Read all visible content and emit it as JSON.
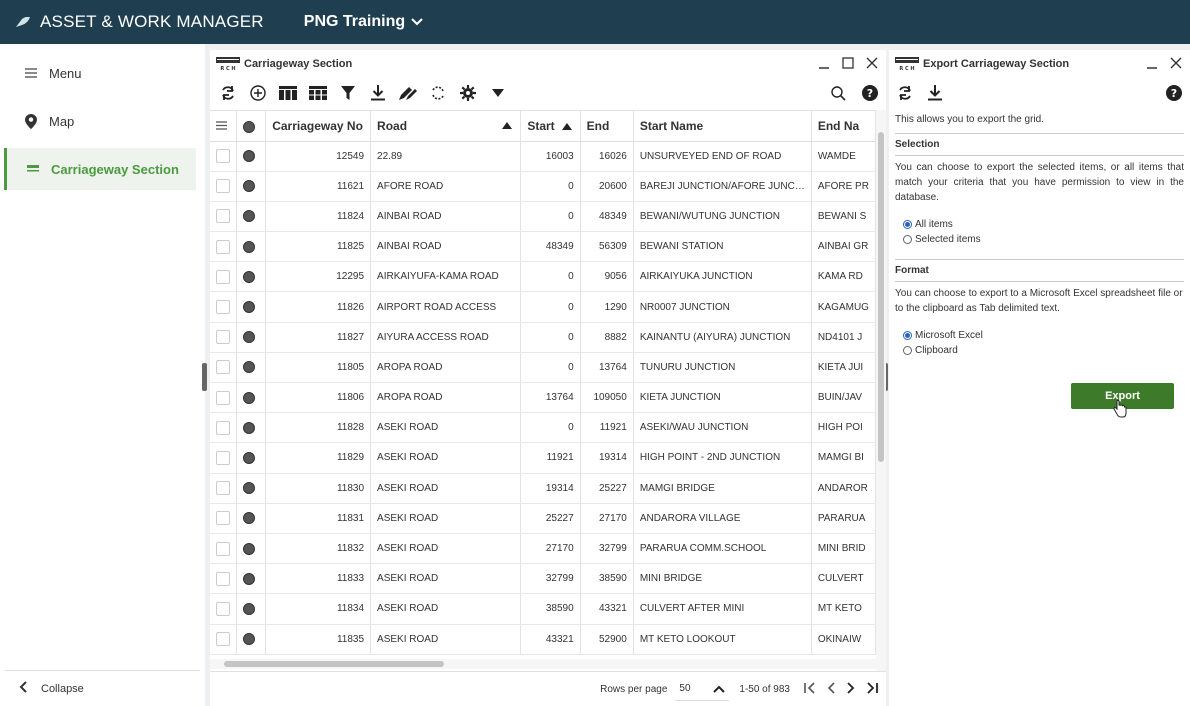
{
  "app": {
    "title": "ASSET & WORK MANAGER",
    "tenant": "PNG Training"
  },
  "sidebar": {
    "items": [
      {
        "label": "Menu",
        "icon": "hamburger-icon"
      },
      {
        "label": "Map",
        "icon": "map-pin-icon"
      },
      {
        "label": "Carriageway Section",
        "icon": "carriageway-icon",
        "active": true
      }
    ],
    "collapse_label": "Collapse",
    "accent_color": "#4a9a3e"
  },
  "grid_panel": {
    "title": "Carriageway Section",
    "columns": [
      "",
      "",
      "Carriageway No",
      "Road",
      "Start",
      "End",
      "Start Name",
      "End Na"
    ],
    "rows": [
      {
        "no": "12549",
        "road": "22.89",
        "start": "16003",
        "end": "16026",
        "start_name": "UNSURVEYED END OF ROAD",
        "end_name": "WAMDE"
      },
      {
        "no": "11621",
        "road": "AFORE ROAD",
        "start": "0",
        "end": "20600",
        "start_name": "BAREJI JUNCTION/AFORE JUNC…",
        "end_name": "AFORE PR"
      },
      {
        "no": "11824",
        "road": "AINBAI ROAD",
        "start": "0",
        "end": "48349",
        "start_name": "BEWANI/WUTUNG JUNCTION",
        "end_name": "BEWANI S"
      },
      {
        "no": "11825",
        "road": "AINBAI ROAD",
        "start": "48349",
        "end": "56309",
        "start_name": "BEWANI STATION",
        "end_name": "AINBAI GR"
      },
      {
        "no": "12295",
        "road": "AIRKAIYUFA-KAMA ROAD",
        "start": "0",
        "end": "9056",
        "start_name": "AIRKAIYUKA JUNCTION",
        "end_name": "KAMA RD"
      },
      {
        "no": "11826",
        "road": "AIRPORT ROAD ACCESS",
        "start": "0",
        "end": "1290",
        "start_name": "NR0007 JUNCTION",
        "end_name": "KAGAMUG"
      },
      {
        "no": "11827",
        "road": "AIYURA ACCESS ROAD",
        "start": "0",
        "end": "8882",
        "start_name": "KAINANTU (AIYURA) JUNCTION",
        "end_name": "ND4101 J"
      },
      {
        "no": "11805",
        "road": "AROPA ROAD",
        "start": "0",
        "end": "13764",
        "start_name": "TUNURU JUNCTION",
        "end_name": "KIETA JUI"
      },
      {
        "no": "11806",
        "road": "AROPA ROAD",
        "start": "13764",
        "end": "109050",
        "start_name": "KIETA JUNCTION",
        "end_name": "BUIN/JAV"
      },
      {
        "no": "11828",
        "road": "ASEKI ROAD",
        "start": "0",
        "end": "11921",
        "start_name": "ASEKI/WAU JUNCTION",
        "end_name": "HIGH POI"
      },
      {
        "no": "11829",
        "road": "ASEKI ROAD",
        "start": "11921",
        "end": "19314",
        "start_name": "HIGH POINT - 2ND JUNCTION",
        "end_name": "MAMGI BI"
      },
      {
        "no": "11830",
        "road": "ASEKI ROAD",
        "start": "19314",
        "end": "25227",
        "start_name": "MAMGI BRIDGE",
        "end_name": "ANDAROR"
      },
      {
        "no": "11831",
        "road": "ASEKI ROAD",
        "start": "25227",
        "end": "27170",
        "start_name": "ANDARORA VILLAGE",
        "end_name": "PARARUA"
      },
      {
        "no": "11832",
        "road": "ASEKI ROAD",
        "start": "27170",
        "end": "32799",
        "start_name": "PARARUA COMM.SCHOOL",
        "end_name": "MINI BRID"
      },
      {
        "no": "11833",
        "road": "ASEKI ROAD",
        "start": "32799",
        "end": "38590",
        "start_name": "MINI BRIDGE",
        "end_name": "CULVERT"
      },
      {
        "no": "11834",
        "road": "ASEKI ROAD",
        "start": "38590",
        "end": "43321",
        "start_name": "CULVERT AFTER MINI",
        "end_name": "MT KETO"
      },
      {
        "no": "11835",
        "road": "ASEKI ROAD",
        "start": "43321",
        "end": "52900",
        "start_name": "MT KETO LOOKOUT",
        "end_name": "OKINAIW"
      }
    ],
    "pager": {
      "rows_per_page_label": "Rows per page",
      "rows_per_page": "50",
      "range": "1-50 of 983"
    }
  },
  "export_panel": {
    "title": "Export Carriageway Section",
    "intro": "This allows you to export the grid.",
    "selection_heading": "Selection",
    "selection_text": "You can choose to export the selected items, or all items that match your criteria that you have permission to view in the database.",
    "selection_options": [
      "All items",
      "Selected items"
    ],
    "format_heading": "Format",
    "format_text": "You can choose to export to a Microsoft Excel spreadsheet file or to the clipboard as Tab delimited text.",
    "format_options": [
      "Microsoft Excel",
      "Clipboard"
    ],
    "export_label": "Export",
    "export_color": "#3d7a2a"
  }
}
